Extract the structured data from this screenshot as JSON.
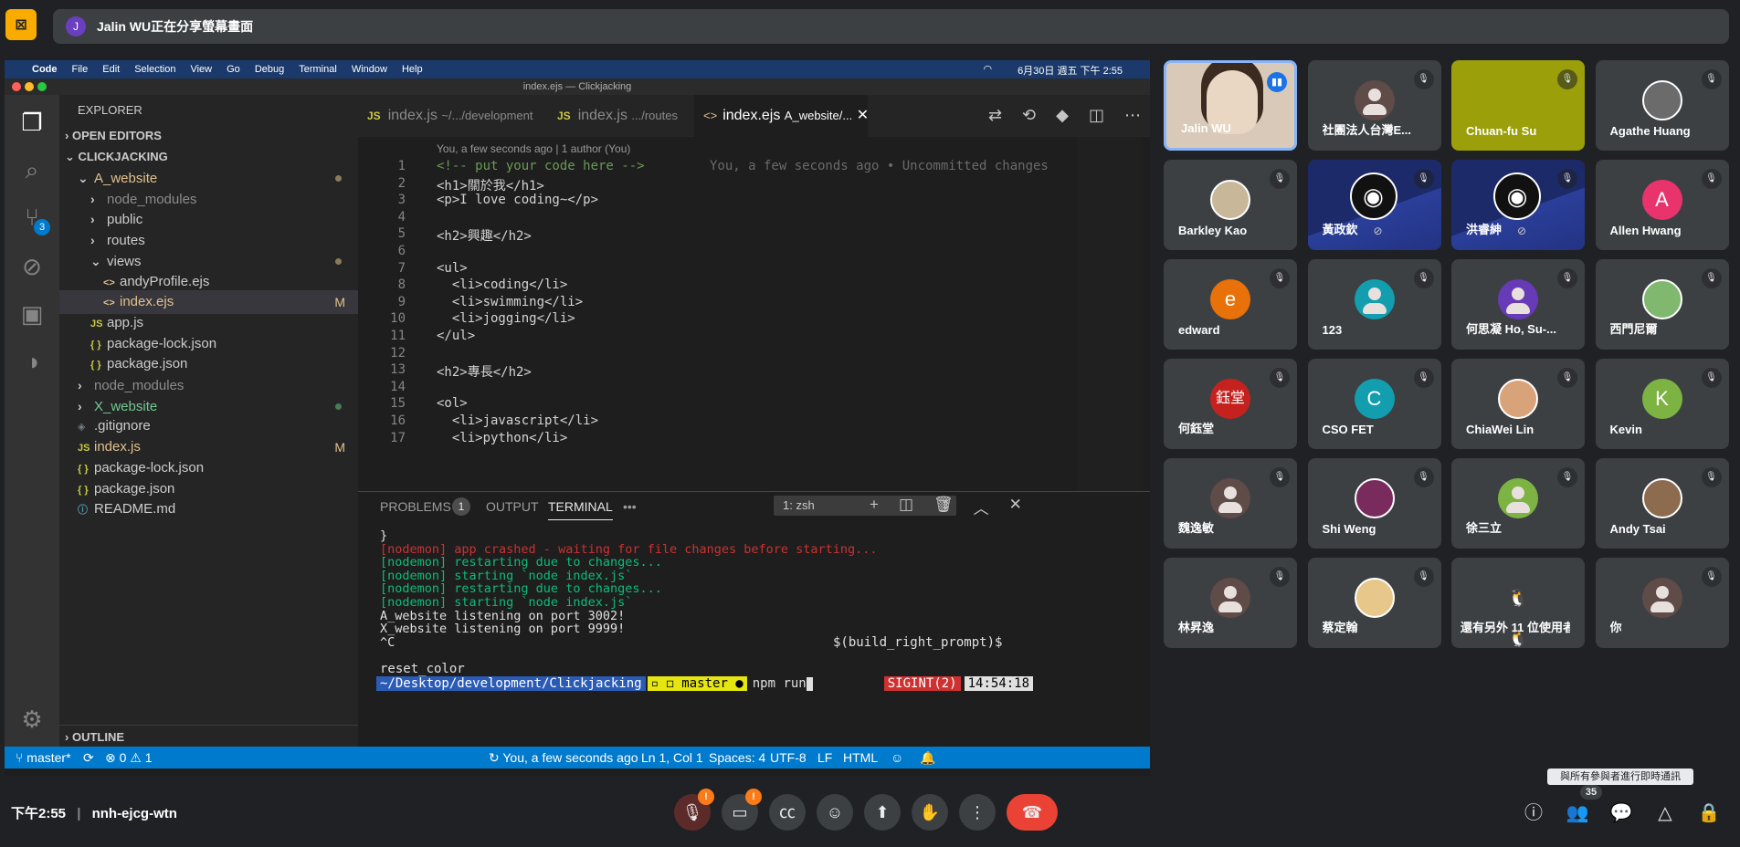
{
  "share_bar": {
    "avatar_letter": "J",
    "text": "Jalin WU正在分享螢幕畫面"
  },
  "mac_menu": {
    "apple": "",
    "app": "Code",
    "items": [
      "File",
      "Edit",
      "Selection",
      "View",
      "Go",
      "Debug",
      "Terminal",
      "Window",
      "Help"
    ],
    "clock": "6月30日 週五 下午 2:55"
  },
  "window_title": "index.ejs — Clickjacking",
  "explorer": {
    "title": "EXPLORER",
    "open_editors": "OPEN EDITORS",
    "project": "CLICKJACKING",
    "items": [
      {
        "label": "A_website",
        "indent": 1
      },
      {
        "label": "node_modules",
        "indent": 2
      },
      {
        "label": "public",
        "indent": 2
      },
      {
        "label": "routes",
        "indent": 2
      },
      {
        "label": "views",
        "indent": 2
      },
      {
        "label": "andyProfile.ejs",
        "indent": 3
      },
      {
        "label": "index.ejs",
        "indent": 3,
        "badge": "M"
      },
      {
        "label": "app.js",
        "indent": 2
      },
      {
        "label": "package-lock.json",
        "indent": 2
      },
      {
        "label": "package.json",
        "indent": 2
      },
      {
        "label": "node_modules",
        "indent": 1
      },
      {
        "label": "X_website",
        "indent": 1
      },
      {
        "label": ".gitignore",
        "indent": 1
      },
      {
        "label": "index.js",
        "indent": 1,
        "badge": "M"
      },
      {
        "label": "package-lock.json",
        "indent": 1
      },
      {
        "label": "package.json",
        "indent": 1
      },
      {
        "label": "README.md",
        "indent": 1
      }
    ],
    "outline": "OUTLINE",
    "scm_badge": "3"
  },
  "tabs": [
    {
      "icon": "JS",
      "name": "index.js",
      "path": "~/.../development"
    },
    {
      "icon": "JS",
      "name": "index.js",
      "path": ".../routes"
    },
    {
      "icon": "<>",
      "name": "index.ejs",
      "path": "A_website/..."
    }
  ],
  "editor": {
    "codelens": "You, a few seconds ago | 1 author (You)",
    "blame": "You, a few seconds ago • Uncommitted changes",
    "lines": [
      {
        "n": "1",
        "text": "<!-- put your code here -->"
      },
      {
        "n": "2",
        "text": "<h1>關於我</h1>"
      },
      {
        "n": "3",
        "text": "<p>I love coding~</p>"
      },
      {
        "n": "4",
        "text": ""
      },
      {
        "n": "5",
        "text": "<h2>興趣</h2>"
      },
      {
        "n": "6",
        "text": ""
      },
      {
        "n": "7",
        "text": "<ul>"
      },
      {
        "n": "8",
        "text": "  <li>coding</li>"
      },
      {
        "n": "9",
        "text": "  <li>swimming</li>"
      },
      {
        "n": "10",
        "text": "  <li>jogging</li>"
      },
      {
        "n": "11",
        "text": "</ul>"
      },
      {
        "n": "12",
        "text": ""
      },
      {
        "n": "13",
        "text": "<h2>專長</h2>"
      },
      {
        "n": "14",
        "text": ""
      },
      {
        "n": "15",
        "text": "<ol>"
      },
      {
        "n": "16",
        "text": "  <li>javascript</li>"
      },
      {
        "n": "17",
        "text": "  <li>python</li>"
      }
    ]
  },
  "panel": {
    "problems": "PROBLEMS",
    "problems_count": "1",
    "output": "OUTPUT",
    "terminal": "TERMINAL",
    "more": "•••",
    "shell": "1: zsh",
    "lines": [
      {
        "text": "}",
        "color": "normal"
      },
      {
        "text": "[nodemon] app crashed - waiting for file changes before starting...",
        "color": "red"
      },
      {
        "text": "[nodemon] restarting due to changes...",
        "color": "green"
      },
      {
        "text": "[nodemon] starting `node index.js`",
        "color": "green"
      },
      {
        "text": "[nodemon] restarting due to changes...",
        "color": "green"
      },
      {
        "text": "[nodemon] starting `node index.js`",
        "color": "green"
      },
      {
        "text": "A_website listening on port 3002!",
        "color": "normal"
      },
      {
        "text": "X_website listening on port 9999!",
        "color": "normal"
      },
      {
        "text": "^C",
        "color": "normal"
      }
    ],
    "right_prompt": "$(build_right_prompt)$",
    "reset": "reset_color",
    "path": "~/Desktop/development/Clickjacking",
    "branch": "master",
    "command": "npm run",
    "sigint": "SIGINT(2)",
    "time": "14:54:18"
  },
  "status": {
    "branch": "master*",
    "errors": "0",
    "warnings": "1",
    "blame": "You, a few seconds ago",
    "position": "Ln 1, Col 1",
    "spaces": "Spaces: 4",
    "encoding": "UTF-8",
    "eol": "LF",
    "language": "HTML"
  },
  "participants": [
    {
      "name": "Jalin WU",
      "type": "video"
    },
    {
      "name": "社團法人台灣E...",
      "type": "generic"
    },
    {
      "name": "Chuan-fu Su",
      "type": "olive"
    },
    {
      "name": "Agathe Huang",
      "type": "photo",
      "color": "#6b6b6b"
    },
    {
      "name": "Barkley Kao",
      "type": "photo",
      "color": "#c9b79a"
    },
    {
      "name": "黃政欽",
      "type": "obs"
    },
    {
      "name": "洪睿紳",
      "type": "obs"
    },
    {
      "name": "Allen Hwang",
      "type": "letter",
      "letter": "A",
      "color": "#e8336d"
    },
    {
      "name": "edward",
      "type": "letter",
      "letter": "e",
      "color": "#e8710a"
    },
    {
      "name": "123",
      "type": "person",
      "color": "#129eaf"
    },
    {
      "name": "何思凝 Ho, Su-...",
      "type": "person",
      "color": "#673ab7"
    },
    {
      "name": "西門尼爾",
      "type": "photo",
      "color": "#7fb86e"
    },
    {
      "name": "何鈺堂",
      "type": "letter",
      "letter": "鈺堂",
      "color": "#c5221f"
    },
    {
      "name": "CSO FET",
      "type": "letter",
      "letter": "C",
      "color": "#129eaf"
    },
    {
      "name": "ChiaWei Lin",
      "type": "photo",
      "color": "#d9a37a"
    },
    {
      "name": "Kevin",
      "type": "letter",
      "letter": "K",
      "color": "#7cb342"
    },
    {
      "name": "魏逸敏",
      "type": "generic"
    },
    {
      "name": "Shi Weng",
      "type": "photo",
      "color": "#7a2b5e"
    },
    {
      "name": "徐三立",
      "type": "person",
      "color": "#7cb342"
    },
    {
      "name": "Andy Tsai",
      "type": "photo",
      "color": "#8c6b4e"
    },
    {
      "name": "林昇逸",
      "type": "generic"
    },
    {
      "name": "蔡定翰",
      "type": "photo",
      "color": "#e7c88a"
    },
    {
      "name": "還有另外 11 位使用者",
      "type": "group"
    },
    {
      "name": "你",
      "type": "generic"
    }
  ],
  "bottom": {
    "time": "下午2:55",
    "meeting_code": "nnh-ejcg-wtn",
    "mic_badge": "!",
    "cam_badge": "!",
    "people_count": "35",
    "tooltip": "與所有參與者進行即時通訊"
  }
}
